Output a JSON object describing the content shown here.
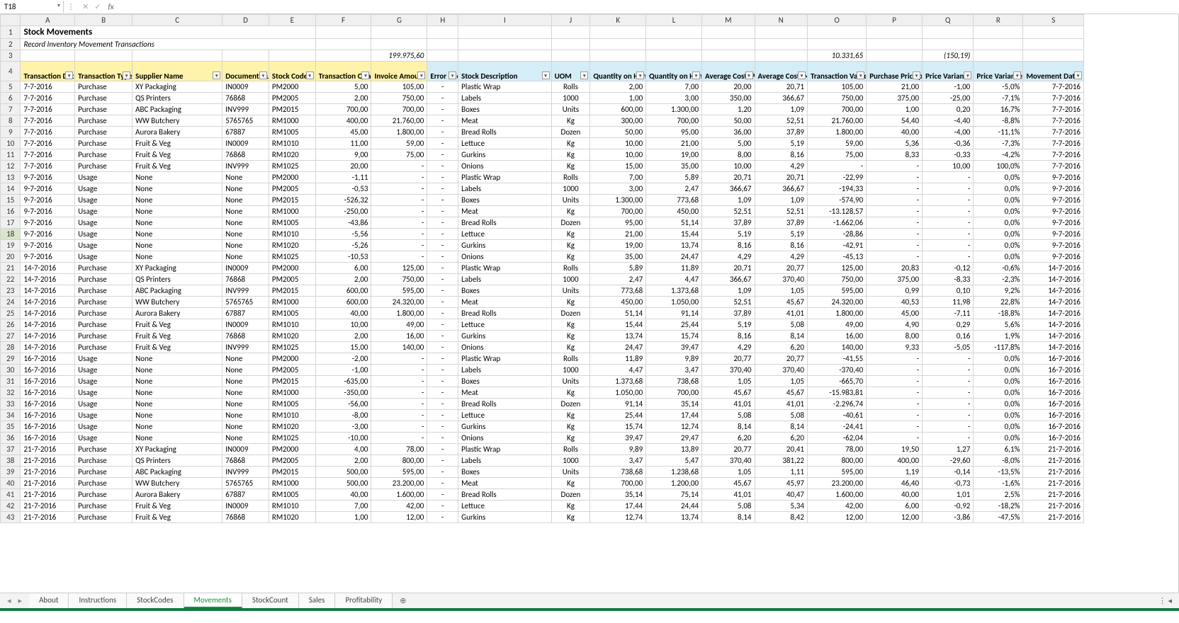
{
  "nameBox": "T18",
  "fx": {
    "x": "✕",
    "check": "✓",
    "label": "fx",
    "value": ""
  },
  "title": "Stock Movements",
  "subtitle": "Record Inventory Movement Transactions",
  "totals": {
    "g": "199.975,60",
    "o": "10.331,65",
    "q": "(150,19)"
  },
  "cols": [
    "A",
    "B",
    "C",
    "D",
    "E",
    "F",
    "G",
    "H",
    "I",
    "J",
    "K",
    "L",
    "M",
    "N",
    "O",
    "P",
    "Q",
    "R",
    "S"
  ],
  "headers": [
    {
      "t": "Transaction Date",
      "c": "y"
    },
    {
      "t": "Transaction Type",
      "c": "y"
    },
    {
      "t": "Supplier Name",
      "c": "y"
    },
    {
      "t": "Document Number",
      "c": "y"
    },
    {
      "t": "Stock Code",
      "c": "y"
    },
    {
      "t": "Transaction Quantity",
      "c": "y"
    },
    {
      "t": "Invoice Amount",
      "c": "y"
    },
    {
      "t": "Error Code",
      "c": "b"
    },
    {
      "t": "Stock Description",
      "c": "b"
    },
    {
      "t": "UOM",
      "c": "b"
    },
    {
      "t": "Quantity on Hand: Prev",
      "c": "b"
    },
    {
      "t": "Quantity on Hand: New",
      "c": "b"
    },
    {
      "t": "Average Cost: Prev",
      "c": "b"
    },
    {
      "t": "Average Cost: New",
      "c": "b"
    },
    {
      "t": "Transaction Value",
      "c": "b"
    },
    {
      "t": "Purchase Price per U",
      "c": "b"
    },
    {
      "t": "Price Variance",
      "c": "b"
    },
    {
      "t": "Price Variance %",
      "c": "b"
    },
    {
      "t": "Movement Date",
      "c": "b"
    }
  ],
  "rows": [
    [
      "7-7-2016",
      "Purchase",
      "XY Packaging",
      "IN0009",
      "PM2000",
      "5,00",
      "105,00",
      "-",
      "Plastic Wrap",
      "Rolls",
      "2,00",
      "7,00",
      "20,00",
      "20,71",
      "105,00",
      "21,00",
      "-1,00",
      "-5,0%",
      "7-7-2016"
    ],
    [
      "7-7-2016",
      "Purchase",
      "QS Printers",
      "76868",
      "PM2005",
      "2,00",
      "750,00",
      "-",
      "Labels",
      "1000",
      "1,00",
      "3,00",
      "350,00",
      "366,67",
      "750,00",
      "375,00",
      "-25,00",
      "-7,1%",
      "7-7-2016"
    ],
    [
      "7-7-2016",
      "Purchase",
      "ABC Packaging",
      "INV999",
      "PM2015",
      "700,00",
      "700,00",
      "-",
      "Boxes",
      "Units",
      "600,00",
      "1.300,00",
      "1,20",
      "1,09",
      "700,00",
      "1,00",
      "0,20",
      "16,7%",
      "7-7-2016"
    ],
    [
      "7-7-2016",
      "Purchase",
      "WW Butchery",
      "5765765",
      "RM1000",
      "400,00",
      "21.760,00",
      "-",
      "Meat",
      "Kg",
      "300,00",
      "700,00",
      "50,00",
      "52,51",
      "21.760,00",
      "54,40",
      "-4,40",
      "-8,8%",
      "7-7-2016"
    ],
    [
      "7-7-2016",
      "Purchase",
      "Aurora Bakery",
      "67887",
      "RM1005",
      "45,00",
      "1.800,00",
      "-",
      "Bread Rolls",
      "Dozen",
      "50,00",
      "95,00",
      "36,00",
      "37,89",
      "1.800,00",
      "40,00",
      "-4,00",
      "-11,1%",
      "7-7-2016"
    ],
    [
      "7-7-2016",
      "Purchase",
      "Fruit & Veg",
      "IN0009",
      "RM1010",
      "11,00",
      "59,00",
      "-",
      "Lettuce",
      "Kg",
      "10,00",
      "21,00",
      "5,00",
      "5,19",
      "59,00",
      "5,36",
      "-0,36",
      "-7,3%",
      "7-7-2016"
    ],
    [
      "7-7-2016",
      "Purchase",
      "Fruit & Veg",
      "76868",
      "RM1020",
      "9,00",
      "75,00",
      "-",
      "Gurkins",
      "Kg",
      "10,00",
      "19,00",
      "8,00",
      "8,16",
      "75,00",
      "8,33",
      "-0,33",
      "-4,2%",
      "7-7-2016"
    ],
    [
      "7-7-2016",
      "Purchase",
      "Fruit & Veg",
      "INV999",
      "RM1025",
      "20,00",
      "-",
      "-",
      "Onions",
      "Kg",
      "15,00",
      "35,00",
      "10,00",
      "4,29",
      "-",
      "-",
      "10,00",
      "100,0%",
      "7-7-2016"
    ],
    [
      "9-7-2016",
      "Usage",
      "None",
      "None",
      "PM2000",
      "-1,11",
      "-",
      "-",
      "Plastic Wrap",
      "Rolls",
      "7,00",
      "5,89",
      "20,71",
      "20,71",
      "-22,99",
      "-",
      "-",
      "0,0%",
      "9-7-2016"
    ],
    [
      "9-7-2016",
      "Usage",
      "None",
      "None",
      "PM2005",
      "-0,53",
      "-",
      "-",
      "Labels",
      "1000",
      "3,00",
      "2,47",
      "366,67",
      "366,67",
      "-194,33",
      "-",
      "-",
      "0,0%",
      "9-7-2016"
    ],
    [
      "9-7-2016",
      "Usage",
      "None",
      "None",
      "PM2015",
      "-526,32",
      "-",
      "-",
      "Boxes",
      "Units",
      "1.300,00",
      "773,68",
      "1,09",
      "1,09",
      "-574,90",
      "-",
      "-",
      "0,0%",
      "9-7-2016"
    ],
    [
      "9-7-2016",
      "Usage",
      "None",
      "None",
      "RM1000",
      "-250,00",
      "-",
      "-",
      "Meat",
      "Kg",
      "700,00",
      "450,00",
      "52,51",
      "52,51",
      "-13.128,57",
      "-",
      "-",
      "0,0%",
      "9-7-2016"
    ],
    [
      "9-7-2016",
      "Usage",
      "None",
      "None",
      "RM1005",
      "-43,86",
      "-",
      "-",
      "Bread Rolls",
      "Dozen",
      "95,00",
      "51,14",
      "37,89",
      "37,89",
      "-1.662,06",
      "-",
      "-",
      "0,0%",
      "9-7-2016"
    ],
    [
      "9-7-2016",
      "Usage",
      "None",
      "None",
      "RM1010",
      "-5,56",
      "-",
      "-",
      "Lettuce",
      "Kg",
      "21,00",
      "15,44",
      "5,19",
      "5,19",
      "-28,86",
      "-",
      "-",
      "0,0%",
      "9-7-2016"
    ],
    [
      "9-7-2016",
      "Usage",
      "None",
      "None",
      "RM1020",
      "-5,26",
      "-",
      "-",
      "Gurkins",
      "Kg",
      "19,00",
      "13,74",
      "8,16",
      "8,16",
      "-42,91",
      "-",
      "-",
      "0,0%",
      "9-7-2016"
    ],
    [
      "9-7-2016",
      "Usage",
      "None",
      "None",
      "RM1025",
      "-10,53",
      "-",
      "-",
      "Onions",
      "Kg",
      "35,00",
      "24,47",
      "4,29",
      "4,29",
      "-45,13",
      "-",
      "-",
      "0,0%",
      "9-7-2016"
    ],
    [
      "14-7-2016",
      "Purchase",
      "XY Packaging",
      "IN0009",
      "PM2000",
      "6,00",
      "125,00",
      "-",
      "Plastic Wrap",
      "Rolls",
      "5,89",
      "11,89",
      "20,71",
      "20,77",
      "125,00",
      "20,83",
      "-0,12",
      "-0,6%",
      "14-7-2016"
    ],
    [
      "14-7-2016",
      "Purchase",
      "QS Printers",
      "76868",
      "PM2005",
      "2,00",
      "750,00",
      "-",
      "Labels",
      "1000",
      "2,47",
      "4,47",
      "366,67",
      "370,40",
      "750,00",
      "375,00",
      "-8,33",
      "-2,3%",
      "14-7-2016"
    ],
    [
      "14-7-2016",
      "Purchase",
      "ABC Packaging",
      "INV999",
      "PM2015",
      "600,00",
      "595,00",
      "-",
      "Boxes",
      "Units",
      "773,68",
      "1.373,68",
      "1,09",
      "1,05",
      "595,00",
      "0,99",
      "0,10",
      "9,2%",
      "14-7-2016"
    ],
    [
      "14-7-2016",
      "Purchase",
      "WW Butchery",
      "5765765",
      "RM1000",
      "600,00",
      "24.320,00",
      "-",
      "Meat",
      "Kg",
      "450,00",
      "1.050,00",
      "52,51",
      "45,67",
      "24.320,00",
      "40,53",
      "11,98",
      "22,8%",
      "14-7-2016"
    ],
    [
      "14-7-2016",
      "Purchase",
      "Aurora Bakery",
      "67887",
      "RM1005",
      "40,00",
      "1.800,00",
      "-",
      "Bread Rolls",
      "Dozen",
      "51,14",
      "91,14",
      "37,89",
      "41,01",
      "1.800,00",
      "45,00",
      "-7,11",
      "-18,8%",
      "14-7-2016"
    ],
    [
      "14-7-2016",
      "Purchase",
      "Fruit & Veg",
      "IN0009",
      "RM1010",
      "10,00",
      "49,00",
      "-",
      "Lettuce",
      "Kg",
      "15,44",
      "25,44",
      "5,19",
      "5,08",
      "49,00",
      "4,90",
      "0,29",
      "5,6%",
      "14-7-2016"
    ],
    [
      "14-7-2016",
      "Purchase",
      "Fruit & Veg",
      "76868",
      "RM1020",
      "2,00",
      "16,00",
      "-",
      "Gurkins",
      "Kg",
      "13,74",
      "15,74",
      "8,16",
      "8,14",
      "16,00",
      "8,00",
      "0,16",
      "1,9%",
      "14-7-2016"
    ],
    [
      "14-7-2016",
      "Purchase",
      "Fruit & Veg",
      "INV999",
      "RM1025",
      "15,00",
      "140,00",
      "-",
      "Onions",
      "Kg",
      "24,47",
      "39,47",
      "4,29",
      "6,20",
      "140,00",
      "9,33",
      "-5,05",
      "-117,8%",
      "14-7-2016"
    ],
    [
      "16-7-2016",
      "Usage",
      "None",
      "None",
      "PM2000",
      "-2,00",
      "-",
      "-",
      "Plastic Wrap",
      "Rolls",
      "11,89",
      "9,89",
      "20,77",
      "20,77",
      "-41,55",
      "-",
      "-",
      "0,0%",
      "16-7-2016"
    ],
    [
      "16-7-2016",
      "Usage",
      "None",
      "None",
      "PM2005",
      "-1,00",
      "-",
      "-",
      "Labels",
      "1000",
      "4,47",
      "3,47",
      "370,40",
      "370,40",
      "-370,40",
      "-",
      "-",
      "0,0%",
      "16-7-2016"
    ],
    [
      "16-7-2016",
      "Usage",
      "None",
      "None",
      "PM2015",
      "-635,00",
      "-",
      "-",
      "Boxes",
      "Units",
      "1.373,68",
      "738,68",
      "1,05",
      "1,05",
      "-665,70",
      "-",
      "-",
      "0,0%",
      "16-7-2016"
    ],
    [
      "16-7-2016",
      "Usage",
      "None",
      "None",
      "RM1000",
      "-350,00",
      "-",
      "-",
      "Meat",
      "Kg",
      "1.050,00",
      "700,00",
      "45,67",
      "45,67",
      "-15.983,81",
      "-",
      "-",
      "0,0%",
      "16-7-2016"
    ],
    [
      "16-7-2016",
      "Usage",
      "None",
      "None",
      "RM1005",
      "-56,00",
      "-",
      "-",
      "Bread Rolls",
      "Dozen",
      "91,14",
      "35,14",
      "41,01",
      "41,01",
      "-2.296,74",
      "-",
      "-",
      "0,0%",
      "16-7-2016"
    ],
    [
      "16-7-2016",
      "Usage",
      "None",
      "None",
      "RM1010",
      "-8,00",
      "-",
      "-",
      "Lettuce",
      "Kg",
      "25,44",
      "17,44",
      "5,08",
      "5,08",
      "-40,61",
      "-",
      "-",
      "0,0%",
      "16-7-2016"
    ],
    [
      "16-7-2016",
      "Usage",
      "None",
      "None",
      "RM1020",
      "-3,00",
      "-",
      "-",
      "Gurkins",
      "Kg",
      "15,74",
      "12,74",
      "8,14",
      "8,14",
      "-24,41",
      "-",
      "-",
      "0,0%",
      "16-7-2016"
    ],
    [
      "16-7-2016",
      "Usage",
      "None",
      "None",
      "RM1025",
      "-10,00",
      "-",
      "-",
      "Onions",
      "Kg",
      "39,47",
      "29,47",
      "6,20",
      "6,20",
      "-62,04",
      "-",
      "-",
      "0,0%",
      "16-7-2016"
    ],
    [
      "21-7-2016",
      "Purchase",
      "XY Packaging",
      "IN0009",
      "PM2000",
      "4,00",
      "78,00",
      "-",
      "Plastic Wrap",
      "Rolls",
      "9,89",
      "13,89",
      "20,77",
      "20,41",
      "78,00",
      "19,50",
      "1,27",
      "6,1%",
      "21-7-2016"
    ],
    [
      "21-7-2016",
      "Purchase",
      "QS Printers",
      "76868",
      "PM2005",
      "2,00",
      "800,00",
      "-",
      "Labels",
      "1000",
      "3,47",
      "5,47",
      "370,40",
      "381,22",
      "800,00",
      "400,00",
      "-29,60",
      "-8,0%",
      "21-7-2016"
    ],
    [
      "21-7-2016",
      "Purchase",
      "ABC Packaging",
      "INV999",
      "PM2015",
      "500,00",
      "595,00",
      "-",
      "Boxes",
      "Units",
      "738,68",
      "1.238,68",
      "1,05",
      "1,11",
      "595,00",
      "1,19",
      "-0,14",
      "-13,5%",
      "21-7-2016"
    ],
    [
      "21-7-2016",
      "Purchase",
      "WW Butchery",
      "5765765",
      "RM1000",
      "500,00",
      "23.200,00",
      "-",
      "Meat",
      "Kg",
      "700,00",
      "1.200,00",
      "45,67",
      "45,97",
      "23.200,00",
      "46,40",
      "-0,73",
      "-1,6%",
      "21-7-2016"
    ],
    [
      "21-7-2016",
      "Purchase",
      "Aurora Bakery",
      "67887",
      "RM1005",
      "40,00",
      "1.600,00",
      "-",
      "Bread Rolls",
      "Dozen",
      "35,14",
      "75,14",
      "41,01",
      "40,47",
      "1.600,00",
      "40,00",
      "1,01",
      "2,5%",
      "21-7-2016"
    ],
    [
      "21-7-2016",
      "Purchase",
      "Fruit & Veg",
      "IN0009",
      "RM1010",
      "7,00",
      "42,00",
      "-",
      "Lettuce",
      "Kg",
      "17,44",
      "24,44",
      "5,08",
      "5,34",
      "42,00",
      "6,00",
      "-0,92",
      "-18,2%",
      "21-7-2016"
    ],
    [
      "21-7-2016",
      "Purchase",
      "Fruit & Veg",
      "76868",
      "RM1020",
      "1,00",
      "12,00",
      "-",
      "Gurkins",
      "Kg",
      "12,74",
      "13,74",
      "8,14",
      "8,42",
      "12,00",
      "12,00",
      "-3,86",
      "-47,5%",
      "21-7-2016"
    ]
  ],
  "selectedRow": 18,
  "sheets": [
    "About",
    "Instructions",
    "StockCodes",
    "Movements",
    "StockCount",
    "Sales",
    "Profitability"
  ],
  "activeSheet": "Movements",
  "align": [
    "l",
    "l",
    "l",
    "l",
    "l",
    "r",
    "r",
    "c",
    "l",
    "c",
    "r",
    "r",
    "r",
    "r",
    "r",
    "r",
    "r",
    "r",
    "r"
  ]
}
